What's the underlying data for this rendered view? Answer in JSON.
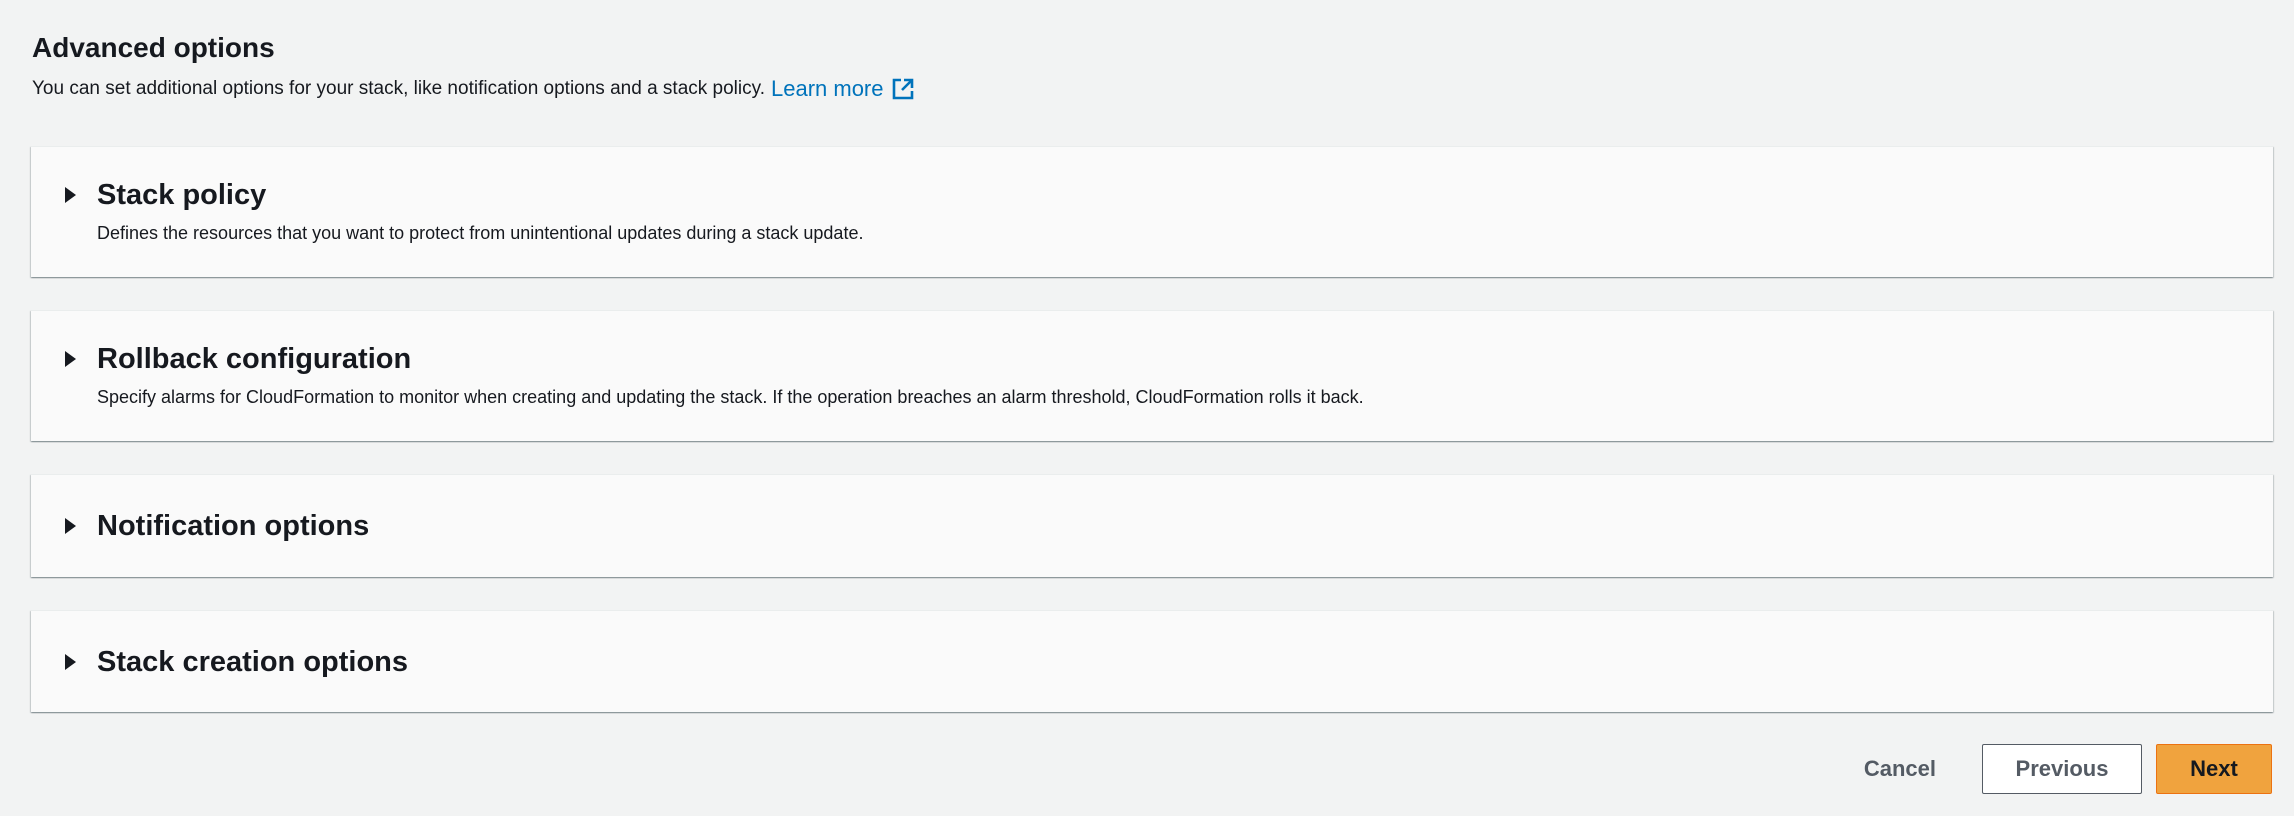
{
  "header": {
    "title": "Advanced options",
    "description": "You can set additional options for your stack, like notification options and a stack policy.",
    "learn_more": "Learn more"
  },
  "panels": [
    {
      "title": "Stack policy",
      "description": "Defines the resources that you want to protect from unintentional updates during a stack update."
    },
    {
      "title": "Rollback configuration",
      "description": "Specify alarms for CloudFormation to monitor when creating and updating the stack. If the operation breaches an alarm threshold, CloudFormation rolls it back."
    },
    {
      "title": "Notification options"
    },
    {
      "title": "Stack creation options"
    }
  ],
  "footer": {
    "cancel_label": "Cancel",
    "previous_label": "Previous",
    "next_label": "Next"
  },
  "colors": {
    "link": "#0073bb",
    "primary_button": "#ec7211",
    "background": "#f2f3f3"
  },
  "icons": {
    "external_link": "external-link-icon",
    "expand": "caret-right-icon"
  }
}
